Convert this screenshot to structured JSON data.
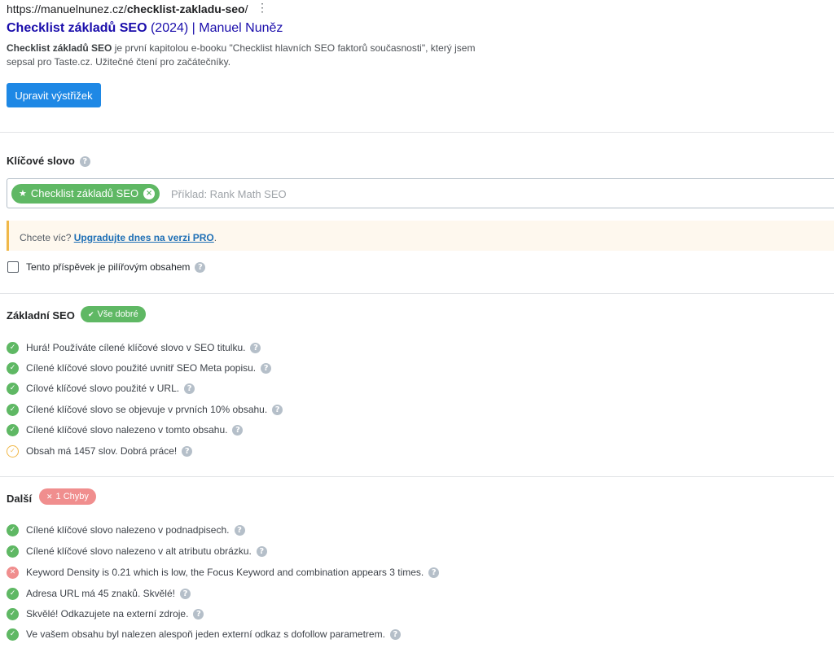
{
  "serp": {
    "url_base": "https://manuelnunez.cz/",
    "url_slug": "checklist-zakladu-seo",
    "url_tail": "/",
    "menu_glyph": "⋮",
    "title_keyword": "Checklist základů SEO",
    "title_rest": " (2024) | Manuel Nuněz",
    "desc_keyword": "Checklist základů SEO",
    "desc_rest": " je první kapitolou e-booku \"Checklist hlavních SEO faktorů současnosti\", který jsem sepsal pro Taste.cz. Užitečné čtení pro začátečníky.",
    "edit_button": "Upravit výstřižek"
  },
  "keyword": {
    "label": "Klíčové slovo",
    "tag": "Checklist základů SEO",
    "placeholder": "Příklad: Rank Math SEO"
  },
  "notice": {
    "prefix": "Chcete víc? ",
    "link": "Upgradujte dnes na verzi PRO",
    "suffix": "."
  },
  "pillar": {
    "label": "Tento příspěvek je pilířovým obsahem",
    "checked": false
  },
  "sections": [
    {
      "title": "Základní SEO",
      "badge": "Vše dobré",
      "badge_type": "good",
      "items": [
        {
          "status": "ok",
          "text": "Hurá! Používáte cílené klíčové slovo v SEO titulku."
        },
        {
          "status": "ok",
          "text": "Cílené klíčové slovo použité uvnitř SEO Meta popisu."
        },
        {
          "status": "ok",
          "text": "Cílové klíčové slovo použité v URL."
        },
        {
          "status": "ok",
          "text": "Cílené klíčové slovo se objevuje v prvních 10% obsahu."
        },
        {
          "status": "ok",
          "text": "Cílené klíčové slovo nalezeno v tomto obsahu."
        },
        {
          "status": "warn",
          "text": "Obsah má 1457 slov. Dobrá práce!"
        }
      ]
    },
    {
      "title": "Další",
      "badge": "1 Chyby",
      "badge_type": "bad",
      "items": [
        {
          "status": "ok",
          "text": "Cílené klíčové slovo nalezeno v podnadpisech."
        },
        {
          "status": "ok",
          "text": "Cílené klíčové slovo nalezeno v alt atributu obrázku."
        },
        {
          "status": "fail",
          "text": "Keyword Density is 0.21 which is low, the Focus Keyword and combination appears 3 times."
        },
        {
          "status": "ok",
          "text": "Adresa URL má 45 znaků. Skvělé!"
        },
        {
          "status": "ok",
          "text": "Skvělé! Odkazujete na externí zdroje."
        },
        {
          "status": "ok",
          "text": "Ve vašem obsahu byl nalezen alespoň jeden externí odkaz s dofollow parametrem."
        }
      ]
    }
  ],
  "icons": {
    "help": "help-circle-icon",
    "ok": "check-circle-icon",
    "fail": "x-circle-icon",
    "warn": "check-circle-outline-icon"
  },
  "colors": {
    "good": "#5fb864",
    "bad": "#f08e8e",
    "warn": "#f0b849",
    "button": "#1e88e5",
    "link": "#1a0dab"
  }
}
